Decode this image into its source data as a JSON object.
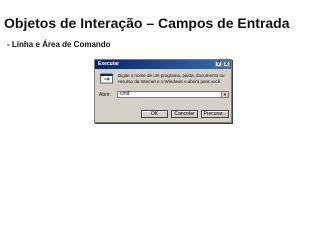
{
  "slide": {
    "title": "Objetos de Interação – Campos de Entrada",
    "subtitle": "-  Linha e Área de Comando"
  },
  "dialog": {
    "title": "Executar",
    "description": "Digite o nome de um programa, pasta, documento ou recurso da Internet e o Windows o abrirá para você.",
    "open_label": "Abrir:",
    "open_value": "cmd",
    "buttons": {
      "ok": "OK",
      "cancel": "Cancelar",
      "browse": "Procurar..."
    },
    "icon": "run-icon",
    "titlebar_buttons": {
      "help": "?",
      "close": "x"
    }
  }
}
